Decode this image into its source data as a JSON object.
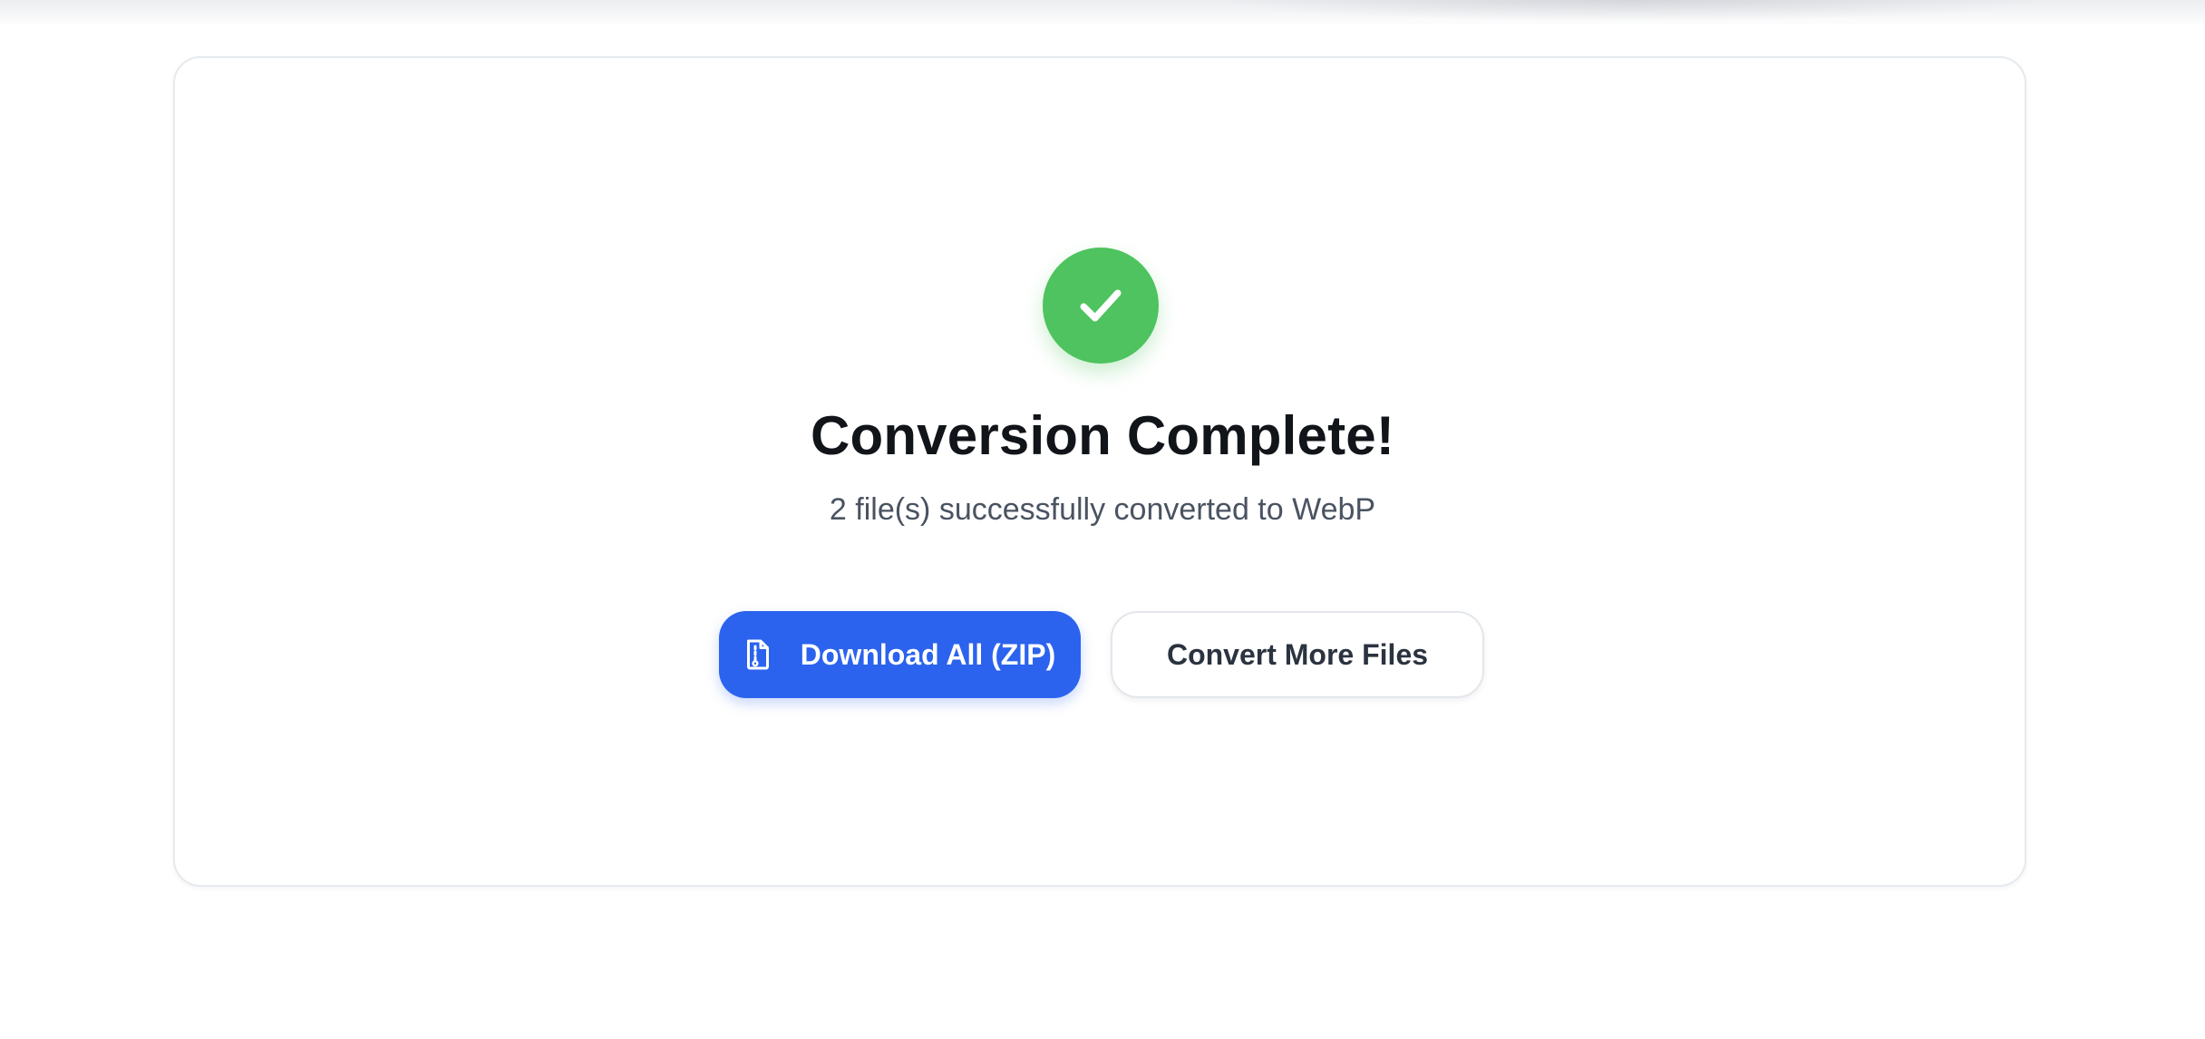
{
  "result": {
    "title": "Conversion Complete!",
    "subtitle": "2 file(s) successfully converted to WebP",
    "status_icon": "check-icon",
    "status_color": "#4ec35f"
  },
  "actions": {
    "download_label": "Download All (ZIP)",
    "download_icon": "zip-file-icon",
    "download_color": "#2b63ee",
    "convert_more_label": "Convert More Files"
  }
}
